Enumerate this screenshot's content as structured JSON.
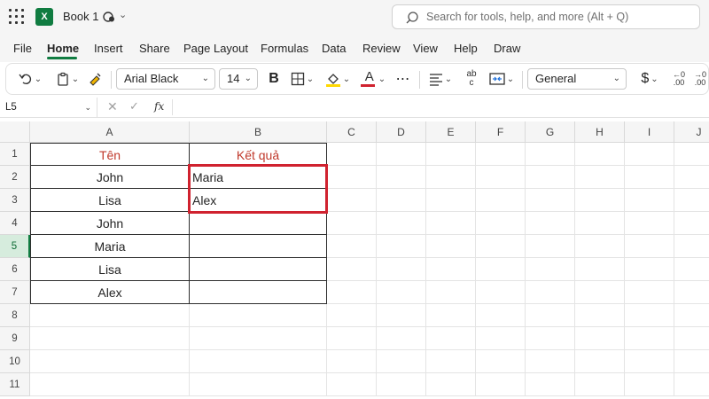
{
  "app": {
    "title": "Book 1",
    "logo_letter": "X"
  },
  "search": {
    "placeholder": "Search for tools, help, and more (Alt + Q)"
  },
  "tabs": [
    {
      "label": "File"
    },
    {
      "label": "Home"
    },
    {
      "label": "Insert"
    },
    {
      "label": "Share"
    },
    {
      "label": "Page Layout"
    },
    {
      "label": "Formulas"
    },
    {
      "label": "Data"
    },
    {
      "label": "Review"
    },
    {
      "label": "View"
    },
    {
      "label": "Help"
    },
    {
      "label": "Draw"
    }
  ],
  "ribbon": {
    "font_name": "Arial Black",
    "font_size": "14",
    "bold_label": "B",
    "font_color_label": "A",
    "number_format": "General",
    "currency_label": "$",
    "dec_inc_top": "←0",
    "dec_inc_bottom": ".00",
    "dec_dec_top": "→0",
    "dec_dec_bottom": ".00",
    "wrap_top": "ab",
    "wrap_bottom": "c"
  },
  "formula_bar": {
    "cell_ref": "L5",
    "fx": "fx",
    "content": ""
  },
  "columns": [
    "A",
    "B",
    "C",
    "D",
    "E",
    "F",
    "G",
    "H",
    "I",
    "J"
  ],
  "rows": [
    "1",
    "2",
    "3",
    "4",
    "5",
    "6",
    "7",
    "8",
    "9",
    "10",
    "11"
  ],
  "selected_row": "5",
  "table": {
    "header_a": "Tên",
    "header_b": "Kết quả",
    "col_a": [
      "John",
      "Lisa",
      "John",
      "Maria",
      "Lisa",
      "Alex"
    ],
    "col_b": [
      "Maria",
      "Alex",
      "",
      "",
      "",
      ""
    ]
  },
  "colors": {
    "excel_green": "#107c41",
    "header_text": "#c0392b",
    "highlight_border": "#d0222f"
  }
}
